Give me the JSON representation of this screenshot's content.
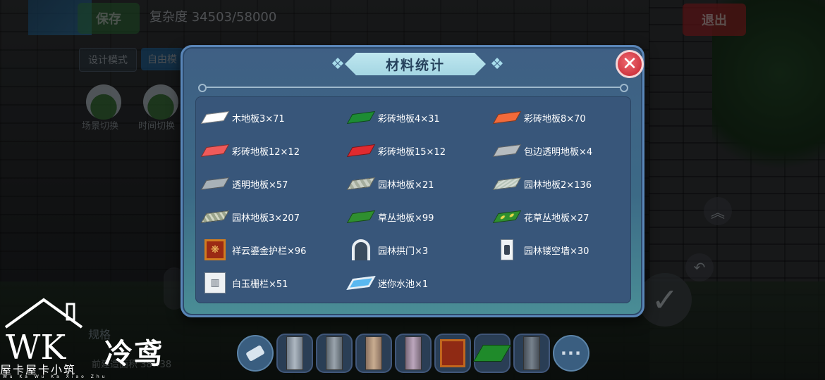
{
  "hud": {
    "save_label": "保存",
    "complexity_text": "复杂度 34503/58000",
    "exit_label": "退出",
    "mode_tabs": [
      "设计模式",
      "自由模"
    ],
    "scene_switch_label": "场景切换",
    "time_switch_label": "时间切换",
    "bottom_label": "规格",
    "bottom_sub_label": "前建造面积 38×38"
  },
  "dialog": {
    "title": "材料统计",
    "close_symbol": "✕",
    "materials": [
      {
        "name": "木地板3×71",
        "icon": "white-floor-tile-icon"
      },
      {
        "name": "彩砖地板4×31",
        "icon": "green-floor-tile-icon"
      },
      {
        "name": "彩砖地板8×70",
        "icon": "orange-floor-tile-icon"
      },
      {
        "name": "彩砖地板12×12",
        "icon": "salmon-floor-tile-icon"
      },
      {
        "name": "彩砖地板15×12",
        "icon": "red-floor-tile-icon"
      },
      {
        "name": "包边透明地板×4",
        "icon": "edged-glass-floor-icon"
      },
      {
        "name": "透明地板×57",
        "icon": "glass-floor-icon"
      },
      {
        "name": "园林地板×21",
        "icon": "garden-floor-icon"
      },
      {
        "name": "园林地板2×136",
        "icon": "garden-floor-2-icon"
      },
      {
        "name": "园林地板3×207",
        "icon": "garden-floor-3-icon"
      },
      {
        "name": "草丛地板×99",
        "icon": "grass-floor-icon"
      },
      {
        "name": "花草丛地板×27",
        "icon": "flower-grass-floor-icon"
      },
      {
        "name": "祥云鎏金护栏×96",
        "icon": "cloud-gold-railing-icon"
      },
      {
        "name": "园林拱门×3",
        "icon": "garden-arch-icon"
      },
      {
        "name": "园林镂空墙×30",
        "icon": "garden-hollow-wall-icon"
      },
      {
        "name": "白玉栅栏×51",
        "icon": "white-jade-fence-icon"
      },
      {
        "name": "迷你水池×1",
        "icon": "mini-pool-icon"
      }
    ]
  },
  "hotbar": {
    "more_label": "···",
    "slots": [
      "eraser-icon",
      "stone-pillar-icon",
      "stone-pillar-2-icon",
      "wood-pillar-icon",
      "pink-pillar-icon",
      "railing-sign-icon",
      "grass-block-icon",
      "dark-pillar-icon"
    ]
  },
  "watermark": {
    "name": "冷鸢",
    "brand": "屋卡屋卡小筑",
    "pinyin": "Wu Ka Wu Ka Xiao Zhu",
    "logo_letters": "WK"
  },
  "colors": {
    "dialog_bg": "#3f5f84",
    "title_banner": "#bfe7ef",
    "close_button": "#cf3641",
    "exit_button": "#a42024",
    "save_button": "#2f7a3a"
  }
}
